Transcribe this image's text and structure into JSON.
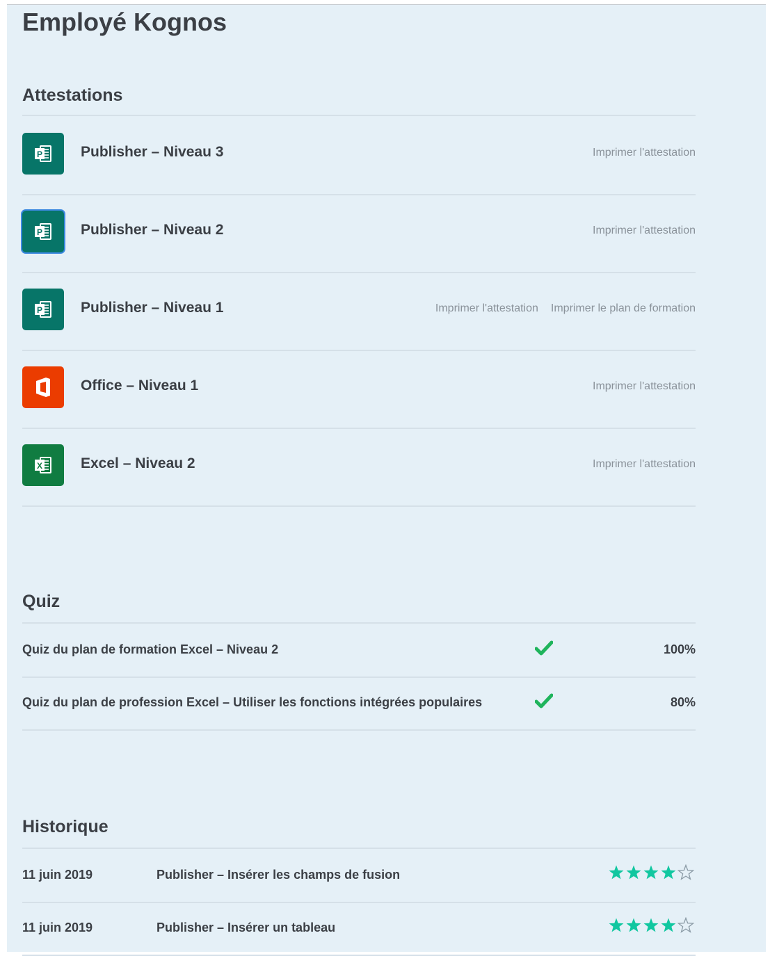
{
  "page": {
    "title": "Employé Kognos"
  },
  "colors": {
    "publisher": "#077568",
    "office": "#eb3c00",
    "excel": "#107c41",
    "check": "#1fb45c",
    "star": "#11c7a0"
  },
  "attestations": {
    "title": "Attestations",
    "items": [
      {
        "name": "Publisher – Niveau 3",
        "icon": "publisher-icon",
        "letter": "P",
        "links": [
          "Imprimer l'attestation"
        ]
      },
      {
        "name": "Publisher – Niveau 2",
        "icon": "publisher-icon",
        "letter": "P",
        "links": [
          "Imprimer l'attestation"
        ]
      },
      {
        "name": "Publisher – Niveau 1",
        "icon": "publisher-icon",
        "letter": "P",
        "links": [
          "Imprimer l'attestation",
          "Imprimer le plan de formation"
        ]
      },
      {
        "name": "Office – Niveau 1",
        "icon": "office-icon",
        "letter": "",
        "links": [
          "Imprimer l'attestation"
        ]
      },
      {
        "name": "Excel – Niveau 2",
        "icon": "excel-icon",
        "letter": "X",
        "links": [
          "Imprimer l'attestation"
        ]
      }
    ]
  },
  "quiz": {
    "title": "Quiz",
    "items": [
      {
        "name": "Quiz du plan de formation Excel – Niveau 2",
        "passed": true,
        "score": "100%"
      },
      {
        "name": "Quiz du plan de profession Excel – Utiliser les fonctions intégrées populaires",
        "passed": true,
        "score": "80%"
      }
    ]
  },
  "history": {
    "title": "Historique",
    "items": [
      {
        "date": "11 juin 2019",
        "title": "Publisher – Insérer les champs de fusion",
        "rating": 4,
        "max_rating": 5
      },
      {
        "date": "11 juin 2019",
        "title": "Publisher – Insérer un tableau",
        "rating": 4,
        "max_rating": 5
      }
    ]
  }
}
